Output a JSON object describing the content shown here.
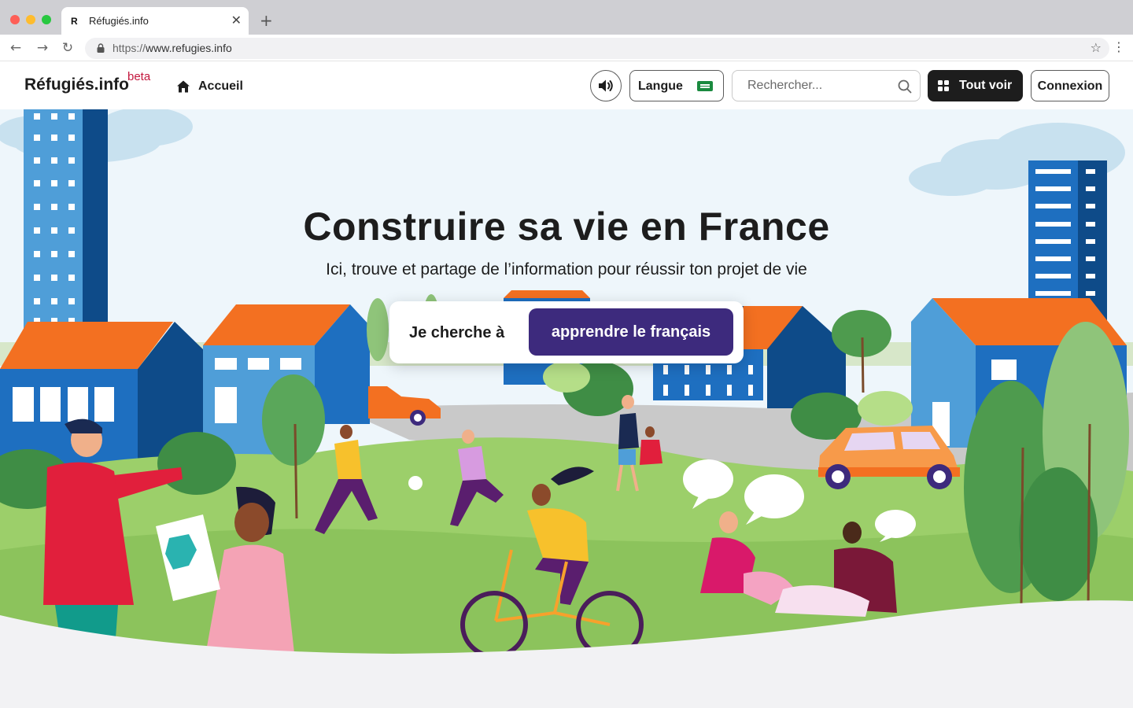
{
  "browser": {
    "tab_favicon": "R",
    "tab_title": "Réfugiés.info",
    "url_prefix": "https://",
    "url_host": "www.refugies.info",
    "icons": [
      "close-icon",
      "plus-icon",
      "back-icon",
      "forward-icon",
      "reload-icon",
      "lock-icon",
      "star-icon",
      "more-icon"
    ]
  },
  "header": {
    "logo": "Réfugiés.info",
    "beta": "beta",
    "home_label": "Accueil",
    "langue_label": "Langue",
    "search_placeholder": "Rechercher...",
    "tout_voir_label": "Tout voir",
    "connexion_label": "Connexion",
    "icons": [
      "home-icon",
      "speaker-icon",
      "flag-icon",
      "search-icon",
      "grid-icon"
    ]
  },
  "hero": {
    "title": "Construire sa vie en France",
    "subtitle": "Ici, trouve et partage de l’information pour réussir ton projet de vie",
    "search_prefix": "Je cherche à",
    "search_value": "apprendre le français"
  },
  "colors": {
    "brand_purple": "#3d2a7d",
    "beta_red": "#c3173d",
    "dark": "#1d1d1d",
    "grass": "#9ccf6a",
    "sky": "#eef6fb"
  }
}
